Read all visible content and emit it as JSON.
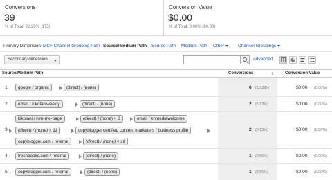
{
  "summary": {
    "conversions": {
      "label": "Conversions",
      "value": "39",
      "sub": "% of Total: 22.29% (175)"
    },
    "conversion_value": {
      "label": "Conversion Value",
      "value": "$0.00",
      "sub": "% of Total: 0.00% ($0.00)"
    }
  },
  "dimensions": {
    "label": "Primary Dimension:",
    "items": [
      "MCF Channel Grouping Path",
      "Source/Medium Path",
      "Source Path",
      "Medium Path",
      "Other",
      "Channel Groupings"
    ],
    "active": "Source/Medium Path"
  },
  "toolbar": {
    "secondary_dimension": "Secondary dimension",
    "search_value": "",
    "advanced": "advanced",
    "view_icons": [
      "table-view-icon",
      "pie-view-icon",
      "bar-view-icon",
      "comparison-view-icon"
    ]
  },
  "table": {
    "columns": [
      "Source/Medium Path",
      "Conversions",
      "Conversion Value"
    ],
    "rows": [
      {
        "num": "1.",
        "chips": [
          "google / organic",
          "(direct) / (none)"
        ],
        "conversions": "6",
        "conv_pct": "(15.38%)",
        "value": "$0.00",
        "value_pct": "(0.00%)"
      },
      {
        "num": "2.",
        "chips": [
          "email / kikolaniweekly",
          "(direct) / (none)"
        ],
        "conversions": "2",
        "conv_pct": "(5.13%)",
        "value": "$0.00",
        "value_pct": "(0.00%)"
      },
      {
        "num": "3.",
        "chips": [
          "kikolani / hire-me-page",
          "(direct) / (none) × 3",
          "email / khmediawelcome",
          "(direct) / (none) × 11",
          "copyblogger certified content marketers / business profile",
          "copyblogger.com / referral",
          "(direct) / (none) × 10"
        ],
        "conversions": "2",
        "conv_pct": "(5.13%)",
        "value": "$0.00",
        "value_pct": "(0.00%)"
      },
      {
        "num": "4.",
        "chips": [
          "freshbooks.com / referral",
          "(direct) / (none)"
        ],
        "conversions": "1",
        "conv_pct": "(2.56%)",
        "value": "$0.00",
        "value_pct": "(0.00%)"
      },
      {
        "num": "5.",
        "chips": [
          "copyblogger.com / referral",
          "(direct) / (none)"
        ],
        "conversions": "1",
        "conv_pct": "(2.56%)",
        "value": "$0.00",
        "value_pct": "(0.00%)"
      }
    ]
  },
  "colors": {
    "link": "#1a57b5",
    "conv_column_bg": "#efefef"
  }
}
